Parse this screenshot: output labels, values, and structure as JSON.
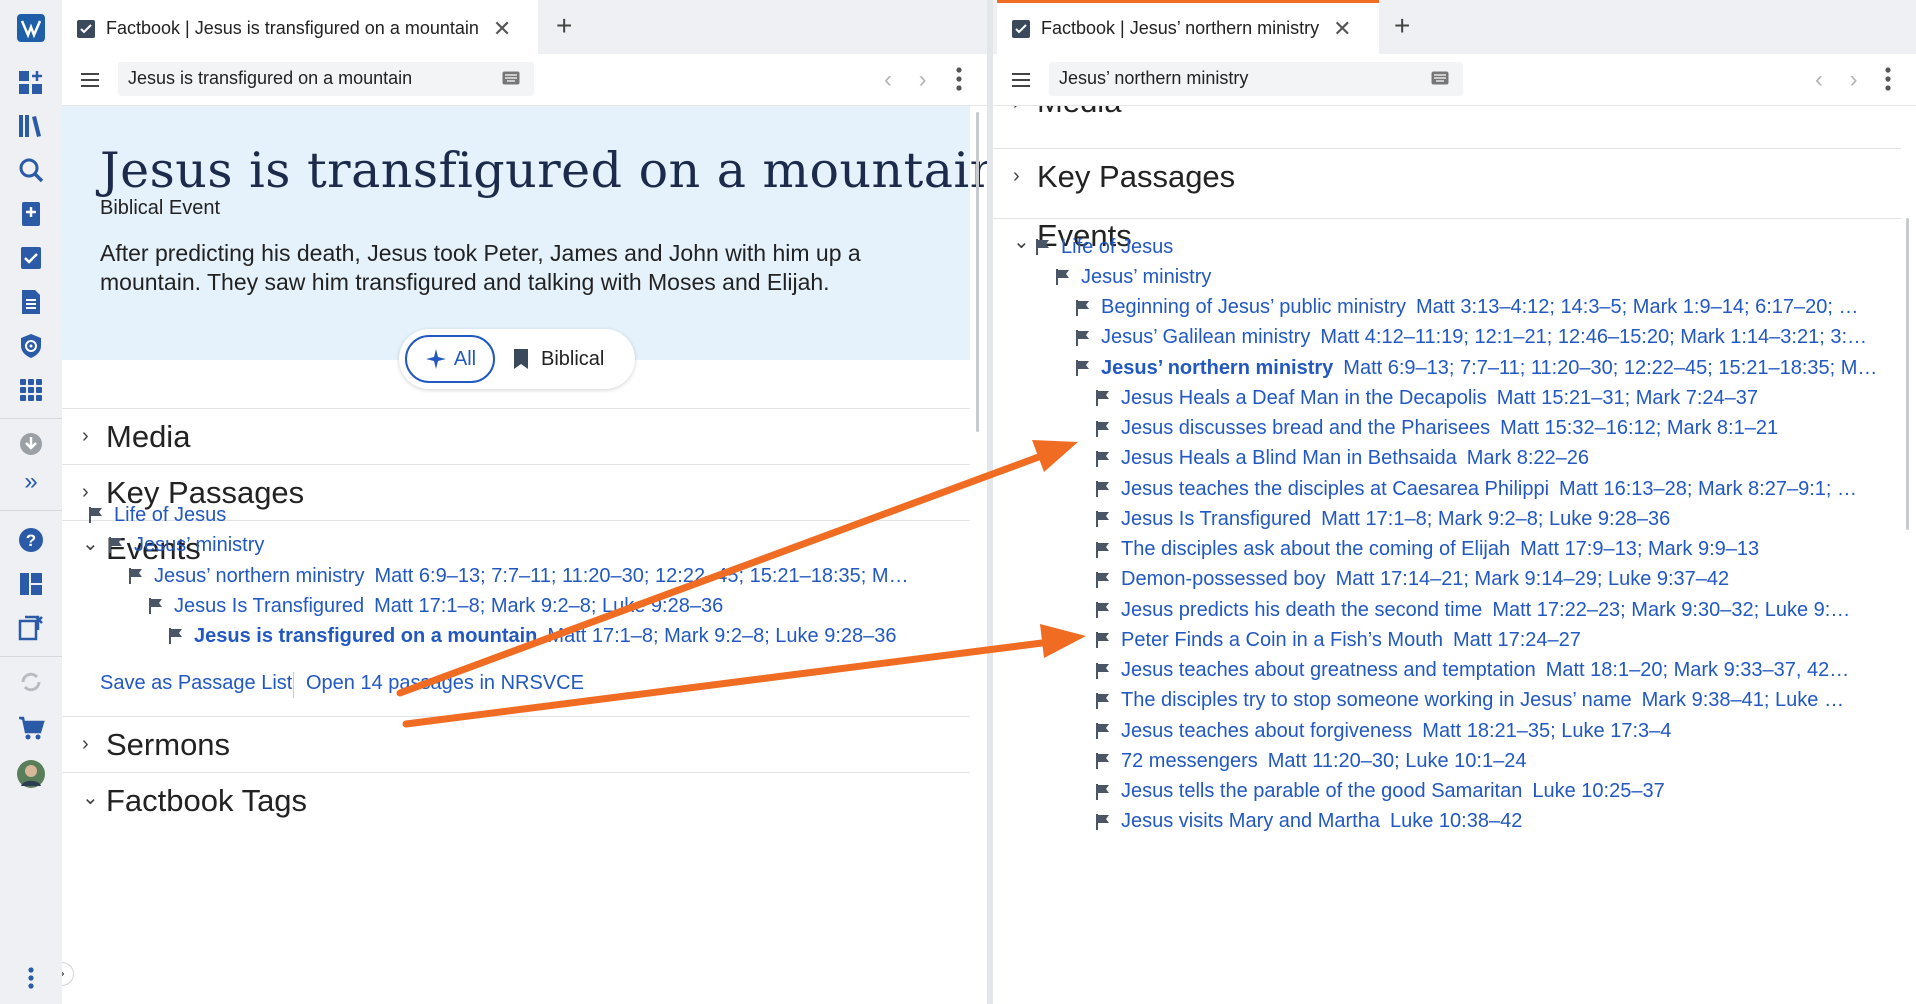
{
  "rail": {
    "items": [
      "logo-icon",
      "dashboard-icon",
      "library-icon",
      "search-icon",
      "bible-add-icon",
      "checklist-icon",
      "document-icon",
      "target-icon",
      "apps-grid-icon",
      "download-icon",
      "expand-icon",
      "help-icon",
      "layout-icon",
      "close-panels-icon",
      "sync-icon",
      "cart-icon",
      "avatar",
      "more-icon"
    ],
    "expand_glyph": "»"
  },
  "left": {
    "tab": {
      "title": "Factbook | Jesus is transfigured on a mountain",
      "close": "✕",
      "add": "+"
    },
    "address": "Jesus is transfigured on a mountain",
    "nav": "‹ ›",
    "hero": {
      "title": "Jesus is transfigured on a mountain",
      "type": "Biblical Event",
      "description": "After predicting his death, Jesus took Peter, James and John with him up a mountain. They saw him transfigured and talking with Moses and Elijah."
    },
    "filters": {
      "all": "All",
      "biblical": "Biblical"
    },
    "sections": {
      "media": "Media",
      "key_passages": "Key Passages",
      "events": "Events",
      "sermons": "Sermons",
      "factbook_tags": "Factbook Tags"
    },
    "chevrons": {
      "collapsed": "›",
      "expanded": "⌄"
    },
    "tree": [
      {
        "title": "Life of Jesus",
        "refs": ""
      },
      {
        "title": "Jesus’ ministry",
        "refs": ""
      },
      {
        "title": "Jesus’ northern ministry",
        "refs": "Matt 6:9–13; 7:7–11; 11:20–30; 12:22–45; 15:21–18:35; M…"
      },
      {
        "title": "Jesus Is Transfigured",
        "refs": "Matt 17:1–8; Mark 9:2–8; Luke 9:28–36"
      },
      {
        "title": "Jesus is transfigured on a mountain",
        "refs": "Matt 17:1–8; Mark 9:2–8; Luke 9:28–36"
      }
    ],
    "actions": {
      "save": "Save as Passage List",
      "open": "Open 14 passages in NRSVCE"
    }
  },
  "right": {
    "tab": {
      "title": "Factbook | Jesus’ northern ministry",
      "close": "✕",
      "add": "+"
    },
    "address": "Jesus’ northern ministry",
    "nav": "‹ ›",
    "sections": {
      "media": "Media",
      "key_passages": "Key Passages",
      "events": "Events"
    },
    "tree": [
      {
        "title": "Life of Jesus",
        "refs": ""
      },
      {
        "title": "Jesus’ ministry",
        "refs": ""
      },
      {
        "title": "Beginning of Jesus’ public ministry",
        "refs": "Matt 3:13–4:12; 14:3–5; Mark 1:9–14; 6:17–20; …"
      },
      {
        "title": "Jesus’ Galilean ministry",
        "refs": "Matt 4:12–11:19; 12:1–21; 12:46–15:20; Mark 1:14–3:21; 3:…"
      },
      {
        "title": "Jesus’ northern ministry",
        "refs": "Matt 6:9–13; 7:7–11; 11:20–30; 12:22–45; 15:21–18:35; M…"
      },
      {
        "title": "Jesus Heals a Deaf Man in the Decapolis",
        "refs": "Matt 15:21–31; Mark 7:24–37"
      },
      {
        "title": "Jesus discusses bread and the Pharisees",
        "refs": "Matt 15:32–16:12; Mark 8:1–21"
      },
      {
        "title": "Jesus Heals a Blind Man in Bethsaida",
        "refs": "Mark 8:22–26"
      },
      {
        "title": "Jesus teaches the disciples at Caesarea Philippi",
        "refs": "Matt 16:13–28; Mark 8:27–9:1; …"
      },
      {
        "title": "Jesus Is Transfigured",
        "refs": "Matt 17:1–8; Mark 9:2–8; Luke 9:28–36"
      },
      {
        "title": "The disciples ask about the coming of Elijah",
        "refs": "Matt 17:9–13; Mark 9:9–13"
      },
      {
        "title": "Demon-possessed boy",
        "refs": "Matt 17:14–21; Mark 9:14–29; Luke 9:37–42"
      },
      {
        "title": "Jesus predicts his death the second time",
        "refs": "Matt 17:22–23; Mark 9:30–32; Luke 9:…"
      },
      {
        "title": "Peter Finds a Coin in a Fish’s Mouth",
        "refs": "Matt 17:24–27"
      },
      {
        "title": "Jesus teaches about greatness and temptation",
        "refs": "Matt 18:1–20; Mark 9:33–37, 42…"
      },
      {
        "title": "The disciples try to stop someone working in Jesus’ name",
        "refs": "Mark 9:38–41; Luke …"
      },
      {
        "title": "Jesus teaches about forgiveness",
        "refs": "Matt 18:21–35; Luke 17:3–4"
      },
      {
        "title": "72 messengers",
        "refs": "Matt 11:20–30; Luke 10:1–24"
      },
      {
        "title": "Jesus tells the parable of the good Samaritan",
        "refs": "Luke 10:25–37"
      },
      {
        "title": "Jesus visits Mary and Martha",
        "refs": "Luke 10:38–42"
      }
    ]
  },
  "colors": {
    "link": "#2158c2",
    "accent": "#ef6c22",
    "hero_bg": "#e5f2fc",
    "brand": "#1f5fa8"
  }
}
